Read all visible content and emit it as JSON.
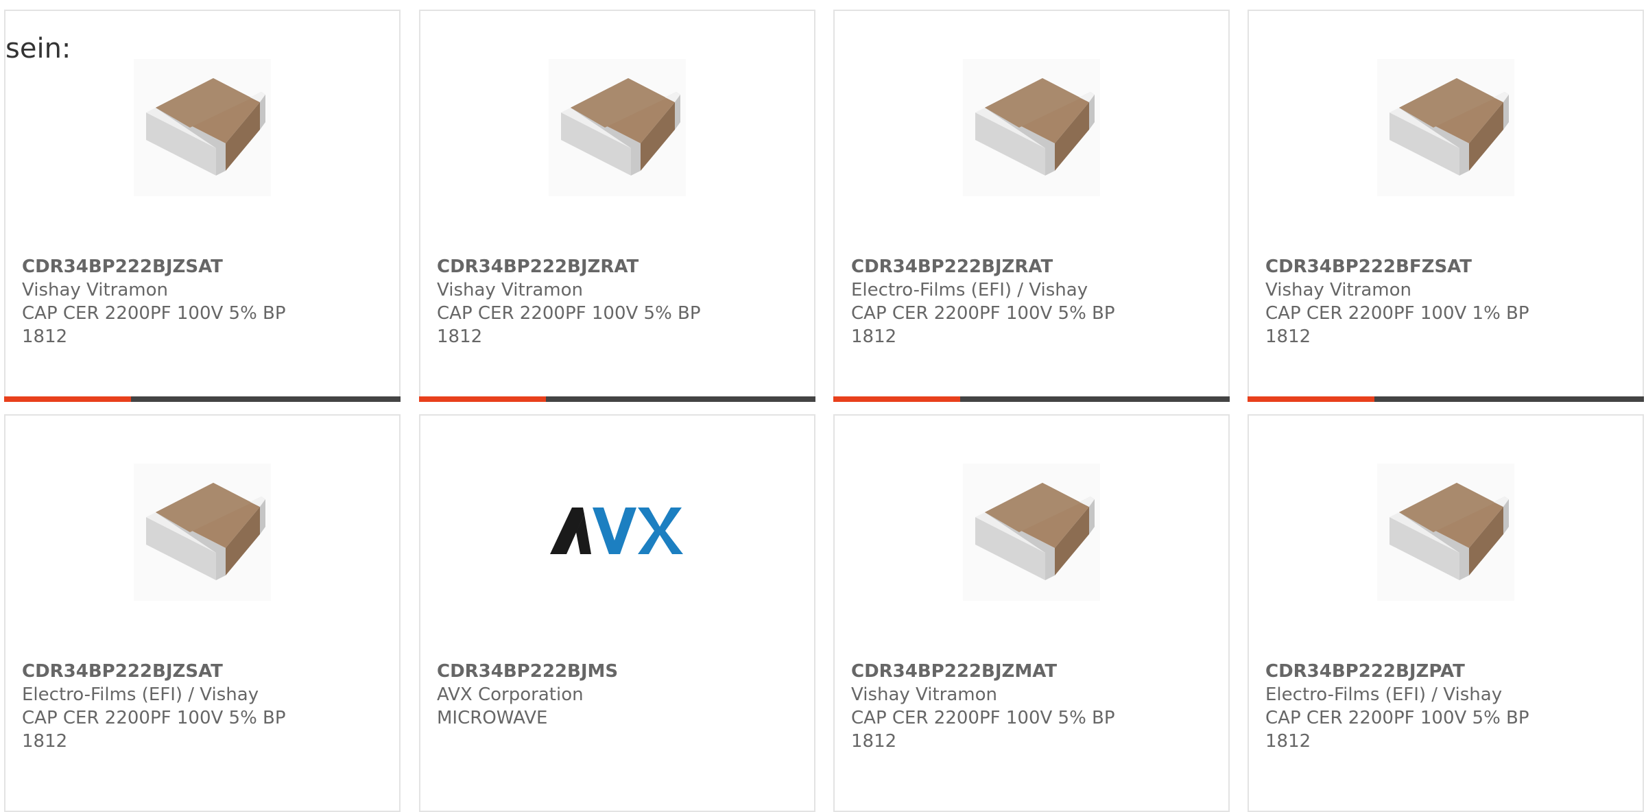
{
  "heading": "sein:",
  "accent_color": "#e8401c",
  "track_color": "#444444",
  "cards": [
    {
      "part": "CDR34BP222BJZSAT",
      "manufacturer": "Vishay Vitramon",
      "desc1": "CAP CER 2200PF 100V 5% BP",
      "desc2": "1812",
      "image": "ceramic-capacitor-chip-icon",
      "progress": 0.32
    },
    {
      "part": "CDR34BP222BJZRAT",
      "manufacturer": "Vishay Vitramon",
      "desc1": "CAP CER 2200PF 100V 5% BP",
      "desc2": "1812",
      "image": "ceramic-capacitor-chip-icon",
      "progress": 0.32
    },
    {
      "part": "CDR34BP222BJZRAT",
      "manufacturer": "Electro-Films (EFI) / Vishay",
      "desc1": "CAP CER 2200PF 100V 5% BP",
      "desc2": "1812",
      "image": "ceramic-capacitor-chip-icon",
      "progress": 0.32
    },
    {
      "part": "CDR34BP222BFZSAT",
      "manufacturer": "Vishay Vitramon",
      "desc1": "CAP CER 2200PF 100V 1% BP",
      "desc2": "1812",
      "image": "ceramic-capacitor-chip-icon",
      "progress": 0.32
    },
    {
      "part": "CDR34BP222BJZSAT",
      "manufacturer": "Electro-Films (EFI) / Vishay",
      "desc1": "CAP CER 2200PF 100V 5% BP",
      "desc2": "1812",
      "image": "ceramic-capacitor-chip-icon"
    },
    {
      "part": "CDR34BP222BJMS",
      "manufacturer": "AVX Corporation",
      "desc1": "MICROWAVE",
      "desc2": "",
      "image": "avx-logo",
      "logo_text": "AVX"
    },
    {
      "part": "CDR34BP222BJZMAT",
      "manufacturer": "Vishay Vitramon",
      "desc1": "CAP CER 2200PF 100V 5% BP",
      "desc2": "1812",
      "image": "ceramic-capacitor-chip-icon"
    },
    {
      "part": "CDR34BP222BJZPAT",
      "manufacturer": "Electro-Films (EFI) / Vishay",
      "desc1": "CAP CER 2200PF 100V 5% BP",
      "desc2": "1812",
      "image": "ceramic-capacitor-chip-icon"
    }
  ]
}
